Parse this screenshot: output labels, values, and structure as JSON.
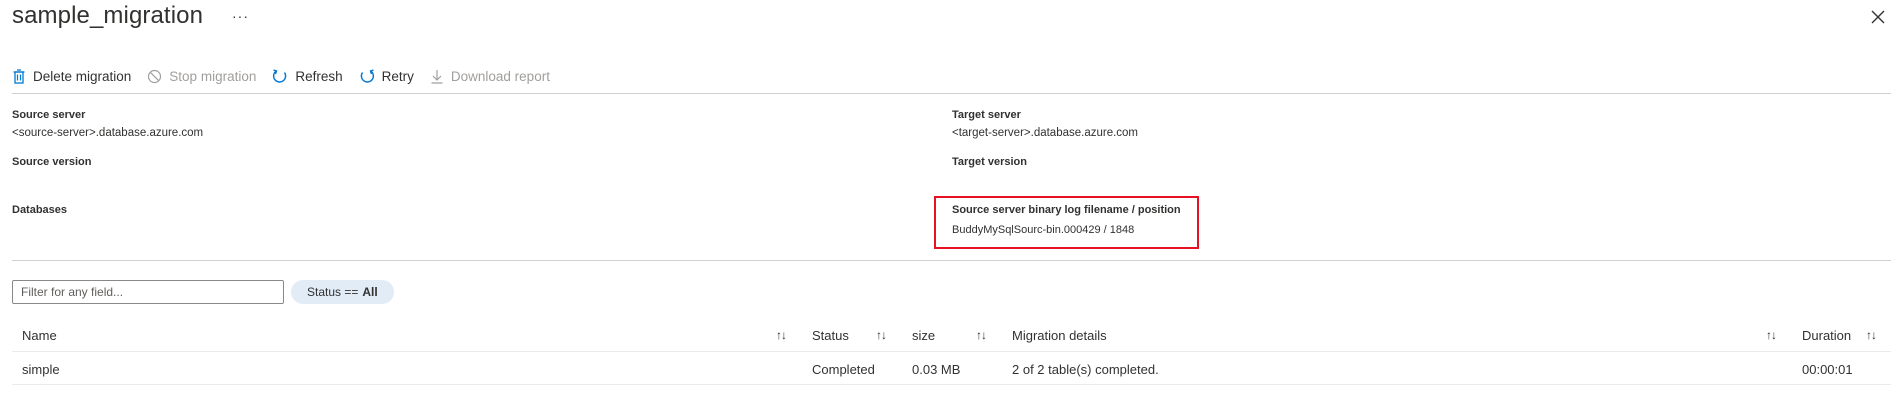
{
  "header": {
    "title": "sample_migration",
    "more_label": "···"
  },
  "toolbar": {
    "buttons": [
      {
        "label": "Delete migration",
        "icon": "trash-icon",
        "enabled": true
      },
      {
        "label": "Stop migration",
        "icon": "stop-circle-icon",
        "enabled": false
      },
      {
        "label": "Refresh",
        "icon": "refresh-icon",
        "enabled": true
      },
      {
        "label": "Retry",
        "icon": "retry-icon",
        "enabled": true
      },
      {
        "label": "Download report",
        "icon": "download-icon",
        "enabled": false
      }
    ]
  },
  "details": {
    "source_server_label": "Source server",
    "source_server_value": "<source-server>.database.azure.com",
    "target_server_label": "Target server",
    "target_server_value": "<target-server>.database.azure.com",
    "source_version_label": "Source version",
    "target_version_label": "Target version",
    "databases_label": "Databases",
    "binlog_label": "Source server binary log filename / position",
    "binlog_value": "BuddyMySqlSourc-bin.000429 / 1848"
  },
  "filter": {
    "placeholder": "Filter for any field...",
    "status_prefix": "Status ==",
    "status_value": "All"
  },
  "table": {
    "columns": [
      "Name",
      "Status",
      "size",
      "Migration details",
      "Duration"
    ],
    "sort_glyph": "↑↓",
    "rows": [
      {
        "name": "simple",
        "status": "Completed",
        "size": "0.03 MB",
        "details": "2 of 2 table(s) completed.",
        "duration": "00:00:01"
      }
    ]
  },
  "colors": {
    "accent": "#0078d4",
    "highlight_border": "#e81123",
    "pill_bg": "#e1ecf7"
  }
}
